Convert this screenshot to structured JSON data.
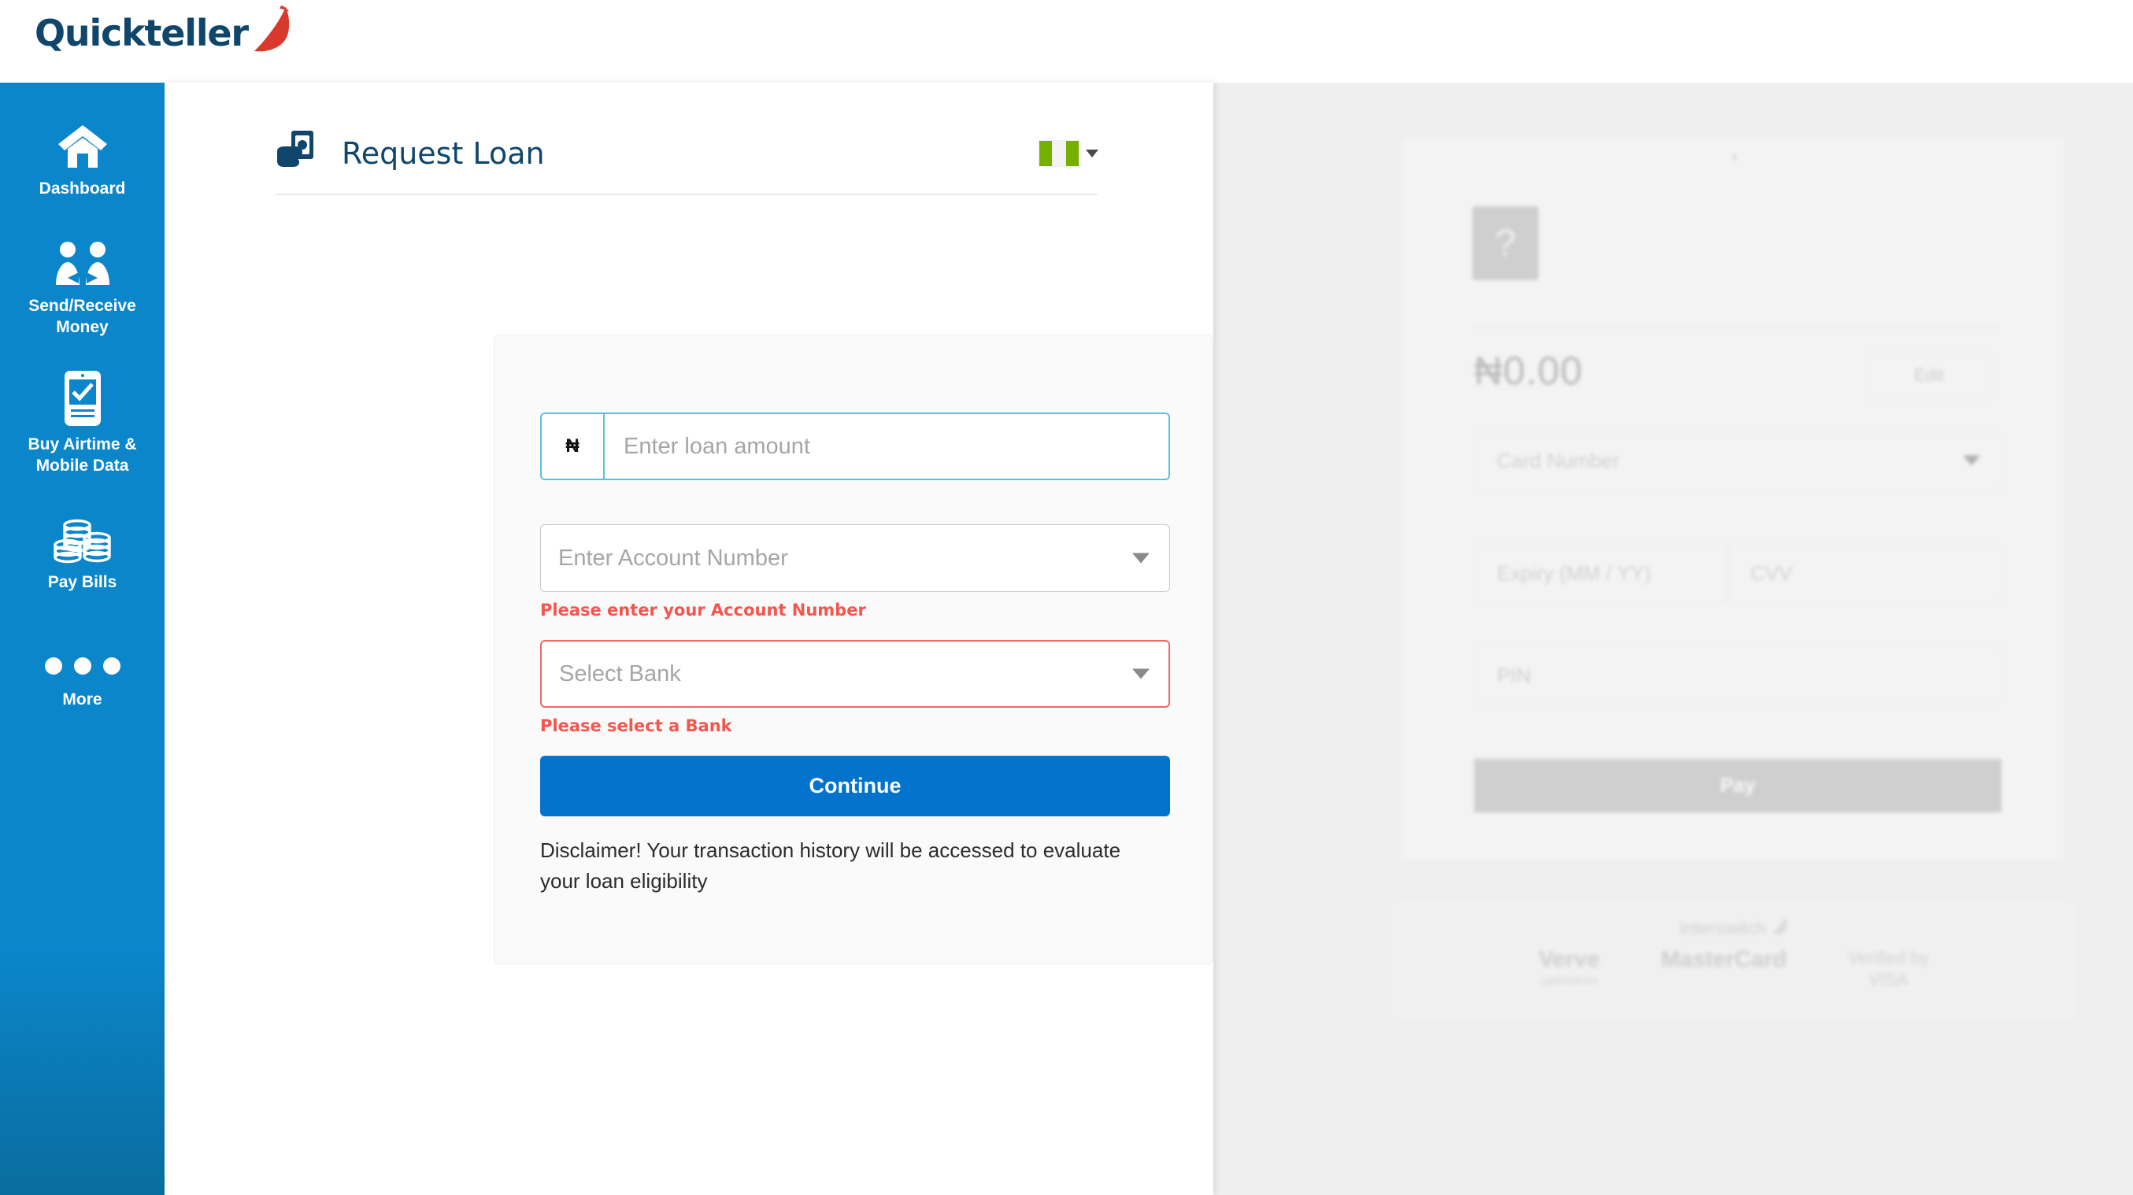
{
  "brand": {
    "logo_text": "Quickteller",
    "logo_icon": "quickteller-swoosh"
  },
  "sidebar": {
    "items": [
      {
        "label": "Dashboard",
        "icon": "home-icon"
      },
      {
        "label": "Send/Receive Money",
        "icon": "people-exchange-icon"
      },
      {
        "label": "Buy Airtime & Mobile Data",
        "icon": "mobile-phone-check-icon"
      },
      {
        "label": "Pay Bills",
        "icon": "coins-stack-icon"
      },
      {
        "label": "More",
        "icon": "three-dots-icon"
      }
    ]
  },
  "header": {
    "title": "Request Loan",
    "icon": "hand-holding-cash-icon",
    "language": {
      "flag": "nigeria-flag-icon",
      "caret": "chevron-down-icon"
    }
  },
  "form": {
    "amount": {
      "currency_symbol": "₦",
      "placeholder": "Enter loan amount",
      "value": ""
    },
    "account": {
      "placeholder": "Enter Account Number",
      "value": "",
      "caret": "chevron-down-icon",
      "error": "Please enter your Account Number"
    },
    "bank": {
      "placeholder": "Select Bank",
      "value": "",
      "caret": "chevron-down-icon",
      "error": "Please select a Bank"
    },
    "submit_label": "Continue",
    "disclaimer": "Disclaimer! Your transaction history will be accessed to evaluate your loan eligibility"
  },
  "payment_panel": {
    "help_icon": "question-mark-icon",
    "amount": "₦0.00",
    "edit_label": "Edit",
    "card_number_placeholder": "Card Number",
    "expiry_placeholder": "Expiry (MM / YY)",
    "cvv_placeholder": "CVV",
    "pin_placeholder": "PIN",
    "pay_label": "Pay",
    "footer": {
      "provider": "Interswitch",
      "provider_icon": "interswitch-swoosh",
      "logos": [
        {
          "name": "Verve",
          "sub": "safetoken"
        },
        {
          "name": "MasterCard",
          "sub": ""
        }
      ],
      "visa_line1": "Verified by",
      "visa_line2": "VISA"
    }
  },
  "colors": {
    "sidebar_blue": "#0b86ca",
    "brand_navy": "#10466b",
    "brand_red": "#d9392c",
    "accent_blue": "#0473ce",
    "error_red": "#f4554c",
    "focus_blue": "#5bc0de",
    "flag_green": "#75b000"
  }
}
